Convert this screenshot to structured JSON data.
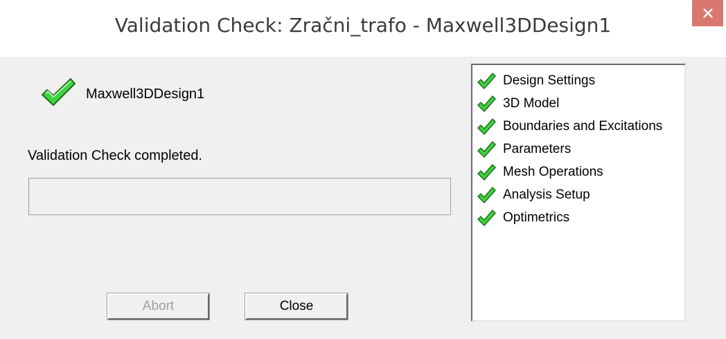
{
  "window": {
    "title": "Validation Check: Zračni_trafo - Maxwell3DDesign1",
    "close_icon": "close-icon"
  },
  "design": {
    "name": "Maxwell3DDesign1",
    "icon": "check-icon"
  },
  "status": {
    "message": "Validation Check completed.",
    "progress_fraction": 0
  },
  "buttons": {
    "abort_label": "Abort",
    "close_label": "Close"
  },
  "checks": {
    "items": [
      {
        "label": "Design Settings"
      },
      {
        "label": "3D Model"
      },
      {
        "label": "Boundaries and Excitations"
      },
      {
        "label": "Parameters"
      },
      {
        "label": "Mesh Operations"
      },
      {
        "label": "Analysis Setup"
      },
      {
        "label": "Optimetrics"
      }
    ]
  },
  "colors": {
    "check_green": "#3fd23f",
    "close_button_red": "#d9776f"
  }
}
